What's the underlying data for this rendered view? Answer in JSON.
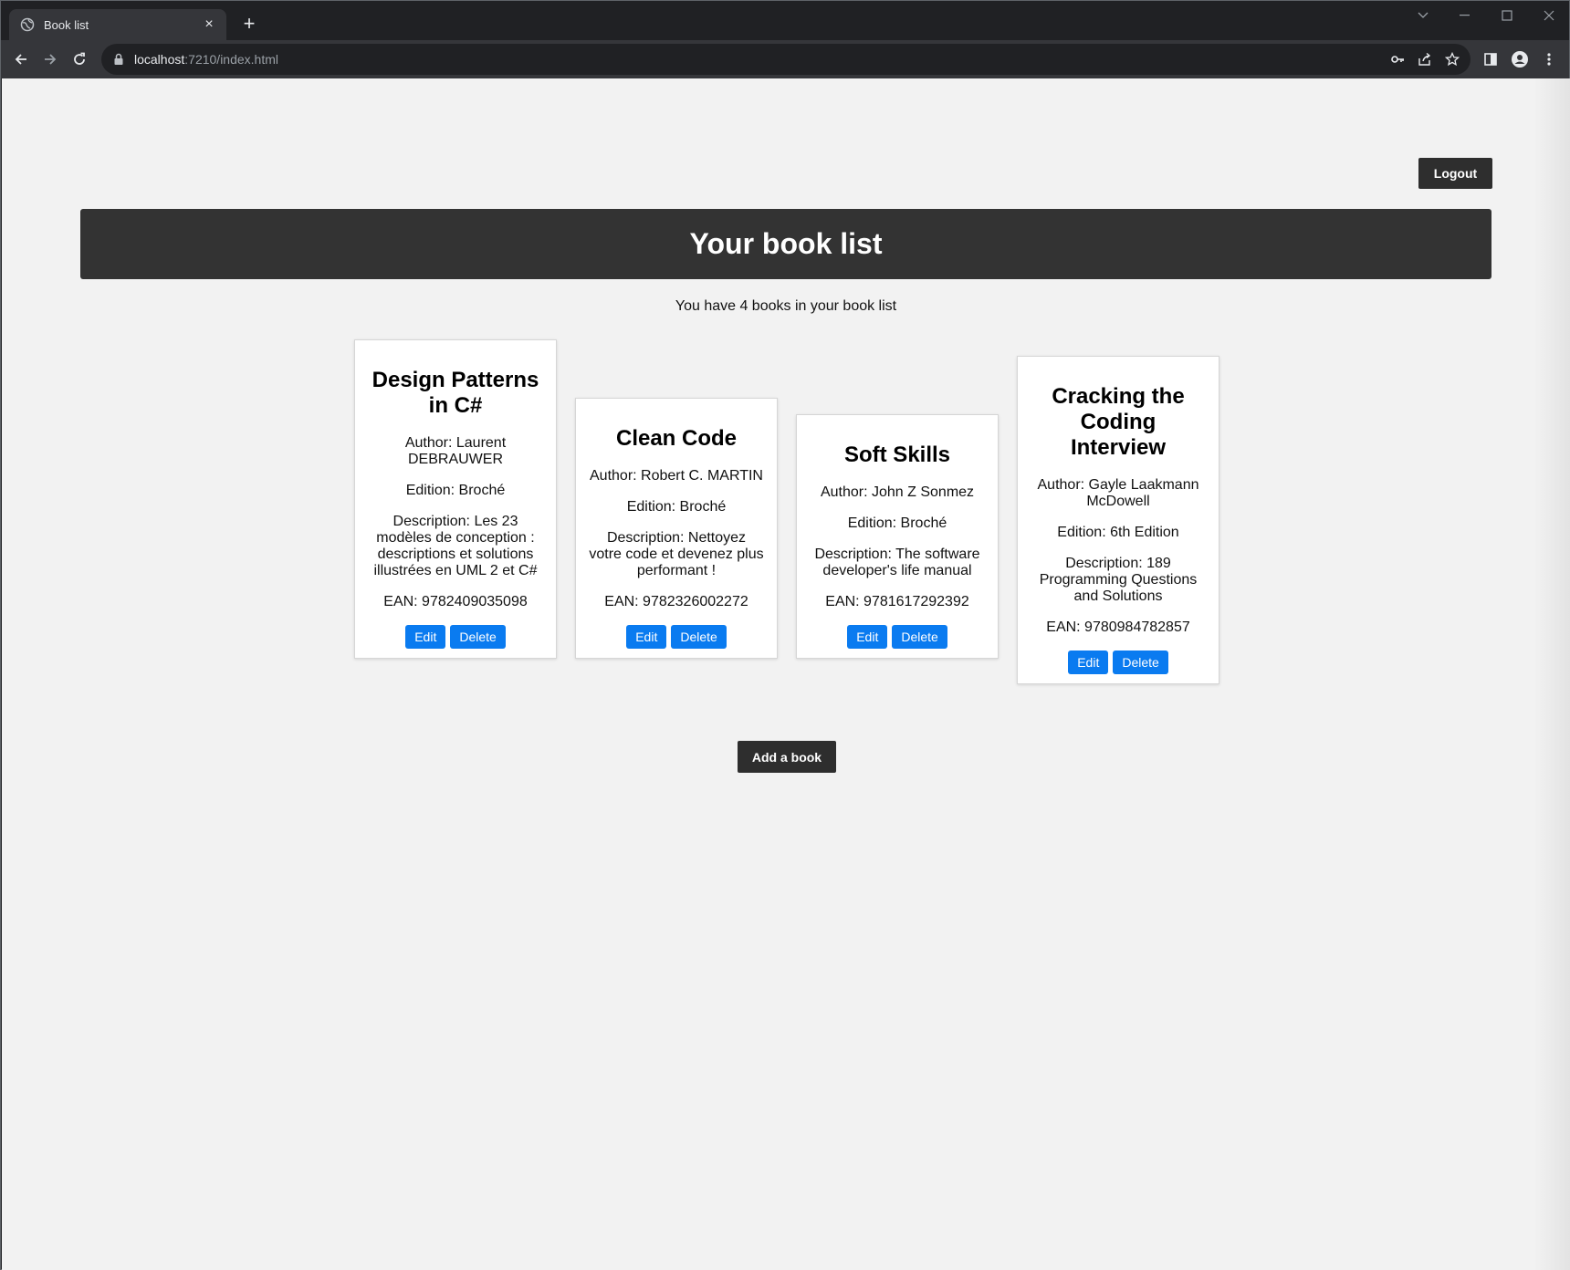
{
  "browser": {
    "tab_title": "Book list",
    "tab_close": "×",
    "new_tab": "+",
    "url_host": "localhost",
    "url_rest": ":7210/index.html"
  },
  "page": {
    "logout_label": "Logout",
    "title": "Your book list",
    "count_text": "You have 4 books in your book list",
    "add_book_label": "Add a book"
  },
  "books": [
    {
      "title": "Design Patterns in C#",
      "author": "Author: Laurent DEBRAUWER",
      "edition": "Edition: Broché",
      "description": "Description: Les 23 modèles de conception : descriptions et solutions illustrées en UML 2 et C#",
      "ean": "EAN: 9782409035098",
      "edit_label": "Edit",
      "delete_label": "Delete"
    },
    {
      "title": "Clean Code",
      "author": "Author: Robert C. MARTIN",
      "edition": "Edition: Broché",
      "description": "Description: Nettoyez votre code et devenez plus performant !",
      "ean": "EAN: 9782326002272",
      "edit_label": "Edit",
      "delete_label": "Delete"
    },
    {
      "title": "Soft Skills",
      "author": "Author: John Z Sonmez",
      "edition": "Edition: Broché",
      "description": "Description: The software developer's life manual",
      "ean": "EAN: 9781617292392",
      "edit_label": "Edit",
      "delete_label": "Delete"
    },
    {
      "title": "Cracking the Coding Interview",
      "author": "Author: Gayle Laakmann McDowell",
      "edition": "Edition: 6th Edition",
      "description": "Description: 189 Programming Questions and Solutions",
      "ean": "EAN: 9780984782857",
      "edit_label": "Edit",
      "delete_label": "Delete"
    }
  ],
  "colors": {
    "page_bg": "#f2f2f2",
    "header_bg": "#333333",
    "button_dark": "#2e2e2e",
    "button_blue": "#0a7bf0"
  }
}
